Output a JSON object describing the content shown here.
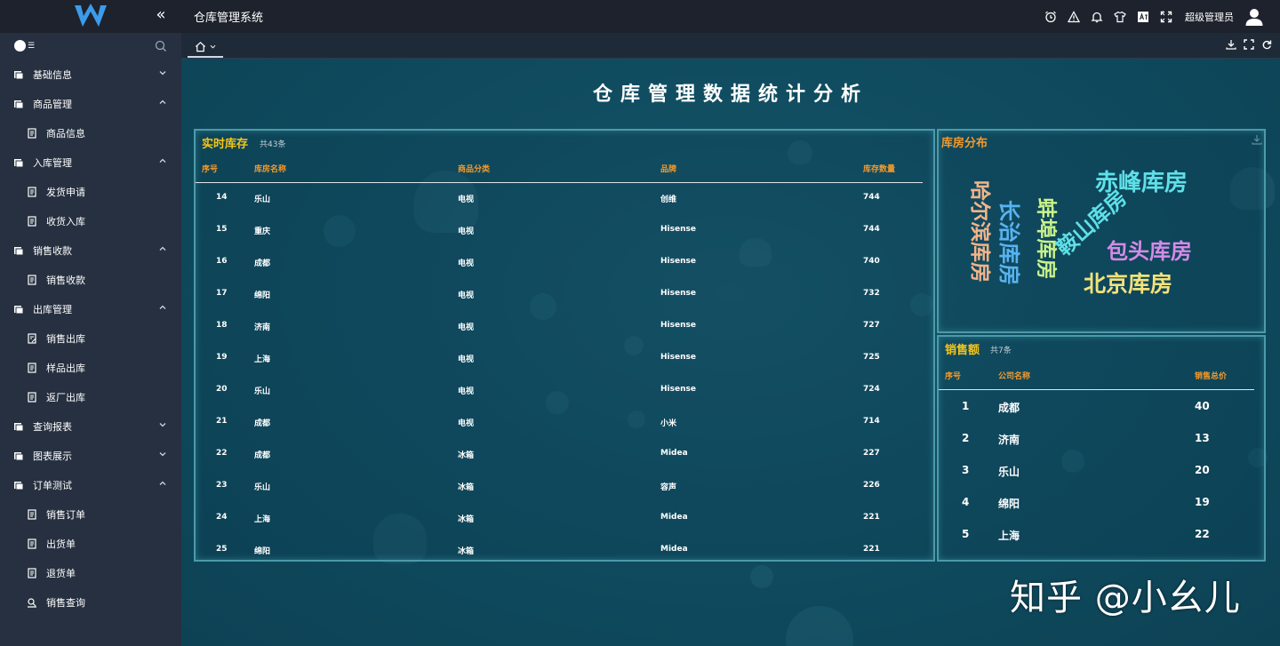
{
  "header": {
    "app_title": "仓库管理系统",
    "user_name": "超级管理员"
  },
  "sidebar": {
    "items": [
      {
        "label": "基础信息",
        "level": 1,
        "icon": "folder-icon",
        "chevron": "down"
      },
      {
        "label": "商品管理",
        "level": 1,
        "icon": "folder-icon",
        "chevron": "up"
      },
      {
        "label": "商品信息",
        "level": 2,
        "icon": "document-icon"
      },
      {
        "label": "入库管理",
        "level": 1,
        "icon": "folder-icon",
        "chevron": "up"
      },
      {
        "label": "发货申请",
        "level": 2,
        "icon": "document-icon"
      },
      {
        "label": "收货入库",
        "level": 2,
        "icon": "document-icon"
      },
      {
        "label": "销售收款",
        "level": 1,
        "icon": "folder-icon",
        "chevron": "up"
      },
      {
        "label": "销售收款",
        "level": 2,
        "icon": "document-icon"
      },
      {
        "label": "出库管理",
        "level": 1,
        "icon": "folder-icon",
        "chevron": "up"
      },
      {
        "label": "销售出库",
        "level": 2,
        "icon": "edit-document-icon"
      },
      {
        "label": "样品出库",
        "level": 2,
        "icon": "document-icon"
      },
      {
        "label": "返厂出库",
        "level": 2,
        "icon": "document-icon"
      },
      {
        "label": "查询报表",
        "level": 1,
        "icon": "folder-icon",
        "chevron": "down"
      },
      {
        "label": "图表展示",
        "level": 1,
        "icon": "folder-icon",
        "chevron": "down"
      },
      {
        "label": "订单测试",
        "level": 1,
        "icon": "folder-icon",
        "chevron": "up"
      },
      {
        "label": "销售订单",
        "level": 2,
        "icon": "document-icon"
      },
      {
        "label": "出货单",
        "level": 2,
        "icon": "document-icon"
      },
      {
        "label": "退货单",
        "level": 2,
        "icon": "document-icon"
      },
      {
        "label": "销售查询",
        "level": 2,
        "icon": "search-list-icon"
      }
    ]
  },
  "dashboard": {
    "title": "仓库管理数据统计分析",
    "inventory": {
      "title": "实时库存",
      "count": "共43条",
      "columns": [
        "序号",
        "库房名称",
        "商品分类",
        "品牌",
        "库存数量"
      ],
      "rows": [
        [
          "14",
          "乐山",
          "电视",
          "创维",
          "744"
        ],
        [
          "15",
          "重庆",
          "电视",
          "Hisense",
          "744"
        ],
        [
          "16",
          "成都",
          "电视",
          "Hisense",
          "740"
        ],
        [
          "17",
          "绵阳",
          "电视",
          "Hisense",
          "732"
        ],
        [
          "18",
          "济南",
          "电视",
          "Hisense",
          "727"
        ],
        [
          "19",
          "上海",
          "电视",
          "Hisense",
          "725"
        ],
        [
          "20",
          "乐山",
          "电视",
          "Hisense",
          "724"
        ],
        [
          "21",
          "成都",
          "电视",
          "小米",
          "714"
        ],
        [
          "22",
          "成都",
          "冰箱",
          "Midea",
          "227"
        ],
        [
          "23",
          "乐山",
          "冰箱",
          "容声",
          "226"
        ],
        [
          "24",
          "上海",
          "冰箱",
          "Midea",
          "221"
        ],
        [
          "25",
          "绵阳",
          "冰箱",
          "Midea",
          "221"
        ]
      ]
    },
    "distribution": {
      "title": "库房分布",
      "words": [
        {
          "text": "赤峰库房",
          "color": "#5fe0e8"
        },
        {
          "text": "包头库房",
          "color": "#d58ae8"
        },
        {
          "text": "北京库房",
          "color": "#f3e27a"
        },
        {
          "text": "鞍山库房",
          "color": "#5fe0e8"
        },
        {
          "text": "蚌埠库房",
          "color": "#c9f28a"
        },
        {
          "text": "长治库房",
          "color": "#58b3f0"
        },
        {
          "text": "哈尔滨库房",
          "color": "#f2b48a"
        }
      ]
    },
    "sales": {
      "title": "销售额",
      "count": "共7条",
      "columns": [
        "序号",
        "公司名称",
        "销售总价"
      ],
      "rows": [
        [
          "1",
          "成都",
          "40"
        ],
        [
          "2",
          "济南",
          "13"
        ],
        [
          "3",
          "乐山",
          "20"
        ],
        [
          "4",
          "绵阳",
          "19"
        ],
        [
          "5",
          "上海",
          "22"
        ]
      ]
    }
  },
  "watermark": "知乎 @小幺儿"
}
